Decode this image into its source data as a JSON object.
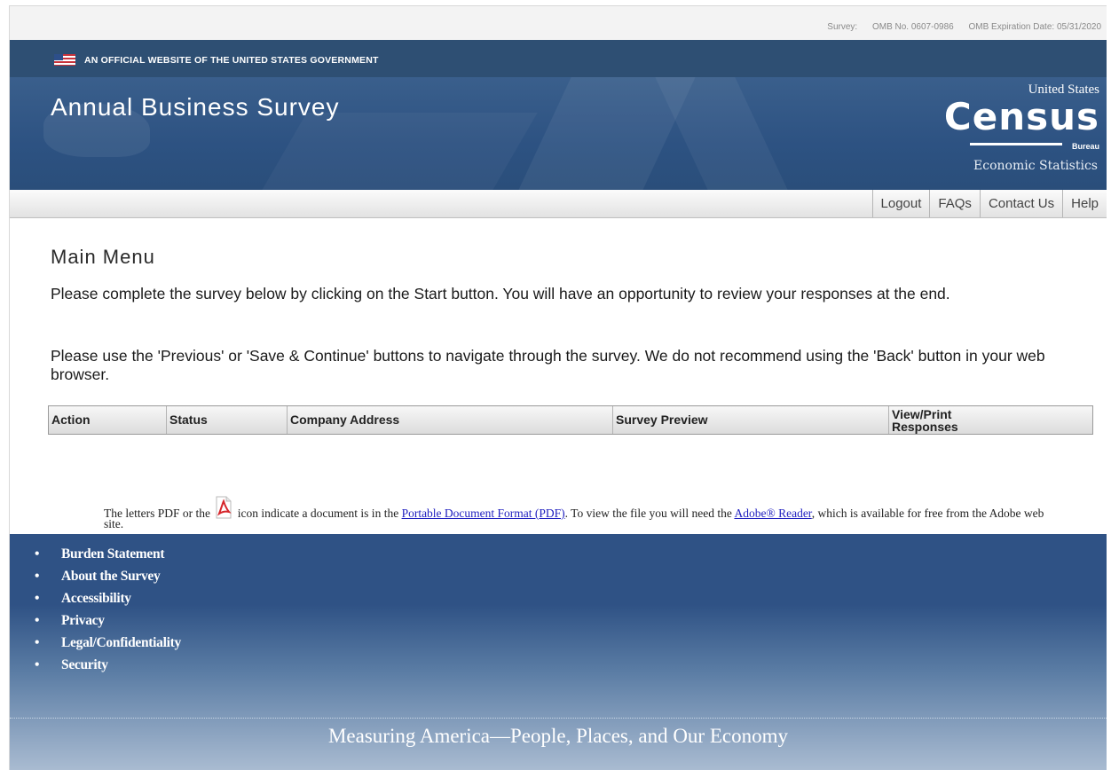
{
  "omb": {
    "survey": "Survey:",
    "omb_no": "OMB No. 0607-0986",
    "expiration": "OMB Expiration Date: 05/31/2020"
  },
  "gov_banner": {
    "text": "AN OFFICIAL WEBSITE OF THE UNITED STATES GOVERNMENT"
  },
  "header": {
    "title": "Annual Business Survey",
    "logo": {
      "top": "United States",
      "main": "Census",
      "sub": "Bureau",
      "division": "Economic Statistics"
    }
  },
  "nav": {
    "logout": "Logout",
    "faqs": "FAQs",
    "contact": "Contact Us",
    "help": "Help"
  },
  "main": {
    "heading": "Main Menu",
    "para1": "Please complete the survey below by clicking on the Start button. You will have an opportunity to review your responses at the end.",
    "para2": "Please use the 'Previous' or 'Save & Continue' buttons to navigate through the survey. We do not recommend using the 'Back' button in your web browser."
  },
  "table": {
    "columns": [
      "Action",
      "Status",
      "Company Address",
      "Survey Preview",
      "View/Print Responses"
    ],
    "col5_line1": "View/Print",
    "col5_line2": "Responses"
  },
  "pdf_note": {
    "before": "The letters PDF or the",
    "middle": "icon indicate a document is in the",
    "link1": "Portable Document Format (PDF)",
    "after_link1": ". To view the file you will need the",
    "link2": "Adobe® Reader",
    "end": ", which is available for free from the Adobe web site."
  },
  "footer": {
    "links": [
      "Burden Statement",
      "About the Survey",
      "Accessibility",
      "Privacy",
      "Legal/Confidentiality",
      "Security"
    ],
    "tagline": "Measuring America—People, Places, and Our Economy"
  },
  "colors": {
    "banner": "#2d5282",
    "gov_bar": "#2e4f73",
    "footer": "#2f5285",
    "link": "#1f1fbf"
  }
}
